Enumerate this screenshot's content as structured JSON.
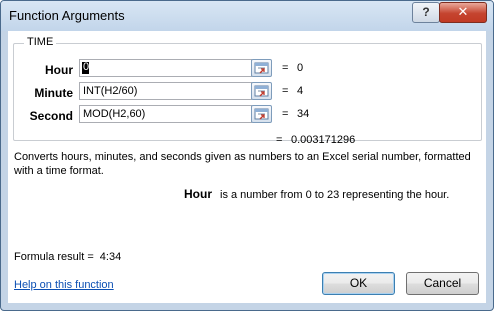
{
  "window": {
    "title": "Function Arguments",
    "help_label": "?",
    "close_label": "✕"
  },
  "function": {
    "name": "TIME"
  },
  "arguments": [
    {
      "label": "Hour",
      "value": "0",
      "result": "0"
    },
    {
      "label": "Minute",
      "value": "INT(H2/60)",
      "result": "4"
    },
    {
      "label": "Second",
      "value": "MOD(H2,60)",
      "result": "34"
    }
  ],
  "equals": "=",
  "function_result": "0.003171296",
  "description": "Converts hours, minutes, and seconds given as numbers to an Excel serial number, formatted with a time format.",
  "argument_help": {
    "name": "Hour",
    "text": "is a number from 0 to 23 representing the hour."
  },
  "formula_result": {
    "label": "Formula result =",
    "value": "4:34"
  },
  "help_link": "Help on this function",
  "buttons": {
    "ok": "OK",
    "cancel": "Cancel"
  },
  "icons": {
    "collapse": "collapse-dialog-icon"
  }
}
